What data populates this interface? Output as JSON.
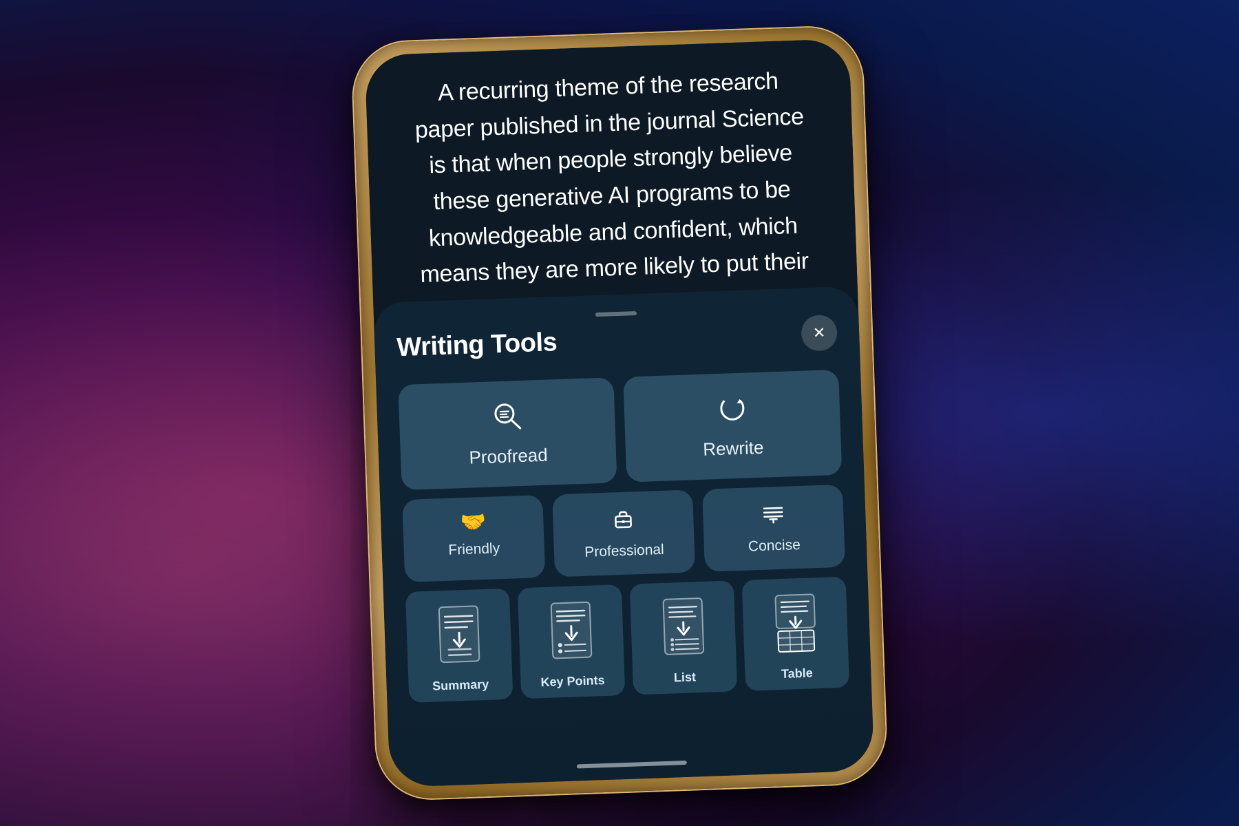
{
  "background": {
    "color1": "#6b1a5a",
    "color2": "#1a0a2e",
    "color3": "#0d2060"
  },
  "article": {
    "text": "A recurring theme of the research paper published in the journal Science is that when people strongly believe these generative AI programs to be knowledgeable and confident, which means they are more likely to put their"
  },
  "panel": {
    "title": "Writing Tools",
    "close_label": "✕",
    "pull_handle": true
  },
  "tools": {
    "large": [
      {
        "id": "proofread",
        "label": "Proofread",
        "icon": "proofread"
      },
      {
        "id": "rewrite",
        "label": "Rewrite",
        "icon": "rewrite"
      }
    ],
    "medium": [
      {
        "id": "friendly",
        "label": "Friendly",
        "icon": "👋"
      },
      {
        "id": "professional",
        "label": "Professional",
        "icon": "briefcase"
      },
      {
        "id": "concise",
        "label": "Concise",
        "icon": "concise"
      }
    ],
    "small": [
      {
        "id": "summary",
        "label": "Summary",
        "icon": "summary"
      },
      {
        "id": "key-points",
        "label": "Key Points",
        "icon": "keypoints"
      },
      {
        "id": "list",
        "label": "List",
        "icon": "list"
      },
      {
        "id": "table",
        "label": "Table",
        "icon": "table"
      }
    ]
  },
  "home_indicator": true
}
